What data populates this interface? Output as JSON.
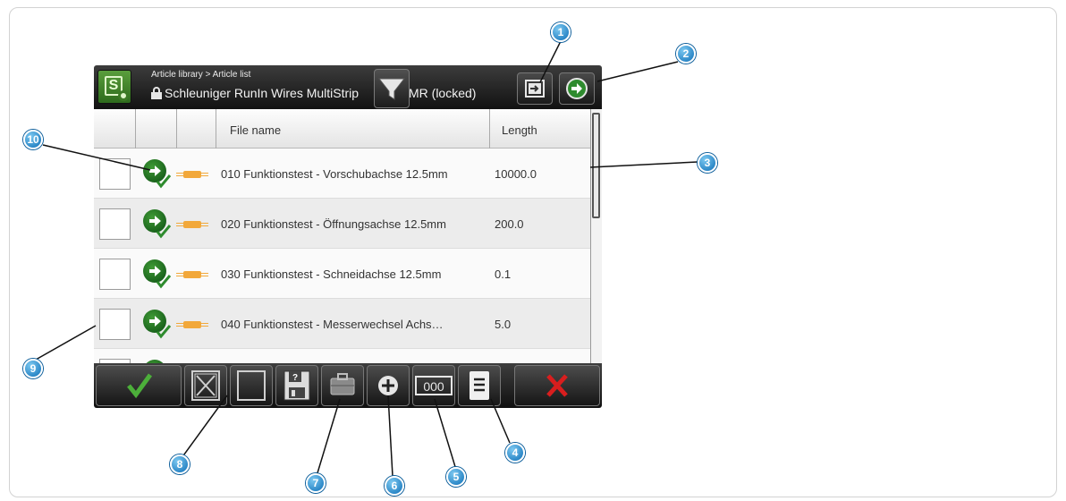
{
  "header": {
    "breadcrumb": "Article library > Article list",
    "article_name_left": "Schleuniger RunIn Wires MultiStrip",
    "article_name_right": "MR (locked)"
  },
  "list": {
    "columns": [
      "File name",
      "Length"
    ],
    "rows": [
      {
        "name": "010 Funktionstest - Vorschubachse 12.5mm",
        "length": "10000.0",
        "status_icon": "run-check-icon",
        "type_icon": "wire-icon"
      },
      {
        "name": "020 Funktionstest - Öffnungsachse 12.5mm",
        "length": "200.0",
        "status_icon": "run-check-icon",
        "type_icon": "wire-icon"
      },
      {
        "name": "030 Funktionstest - Schneidachse 12.5mm",
        "length": "0.1",
        "status_icon": "run-check-icon",
        "type_icon": "wire-icon"
      },
      {
        "name": "040 Funktionstest - Messerwechsel Achs…",
        "length": "5.0",
        "status_icon": "run-check-icon",
        "type_icon": "wire-icon"
      }
    ]
  },
  "toolbar": {
    "counter_label": "000",
    "buttons": [
      "confirm",
      "deselect-all",
      "select-all",
      "save-as",
      "toolbox",
      "add",
      "counter",
      "details",
      "cancel"
    ]
  },
  "callouts": [
    "1",
    "2",
    "3",
    "4",
    "5",
    "6",
    "7",
    "8",
    "9",
    "10"
  ],
  "colors": {
    "accent_green": "#2e8b2e",
    "cancel_red": "#d81e1e",
    "callout_blue": "#1a86cc",
    "wire_orange": "#f2a83a"
  }
}
